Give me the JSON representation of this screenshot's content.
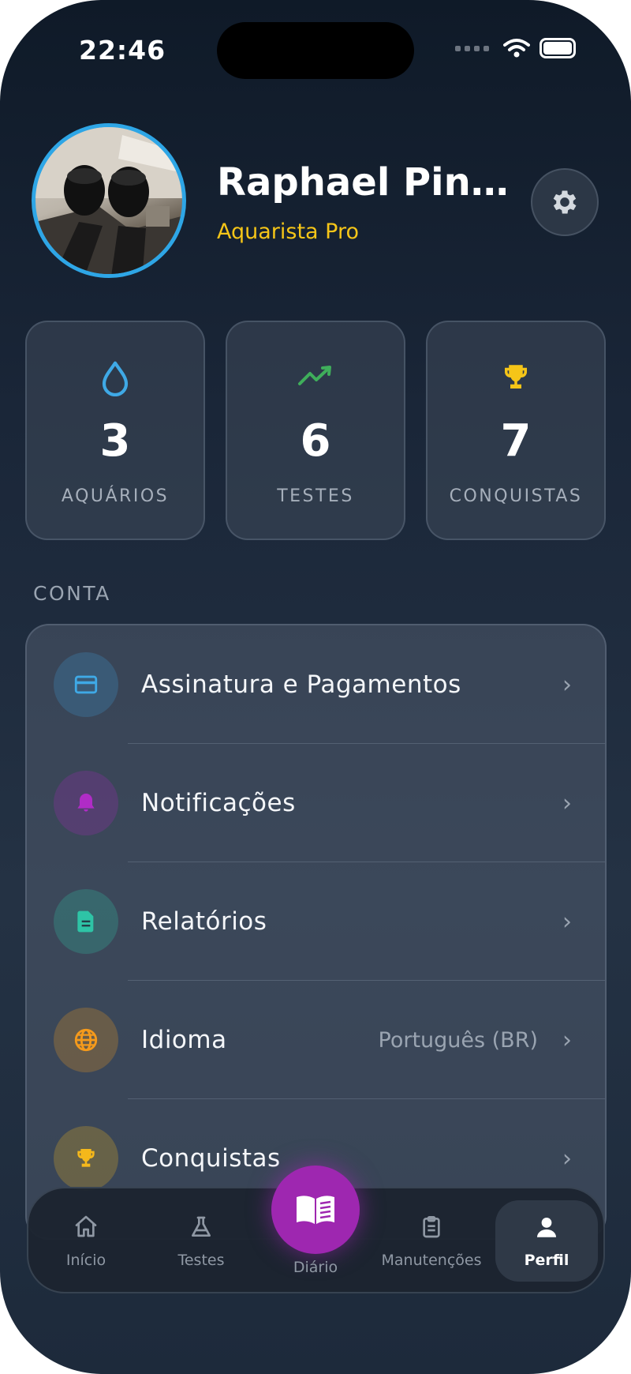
{
  "status_bar": {
    "time": "22:46"
  },
  "profile": {
    "name": "Raphael Pinheir...",
    "tier": "Aquarista Pro"
  },
  "stats": [
    {
      "icon": "water-drop-icon",
      "value": "3",
      "label": "AQUÁRIOS",
      "color": "#3fa9e6"
    },
    {
      "icon": "trending-up-icon",
      "value": "6",
      "label": "TESTES",
      "color": "#3fae5b"
    },
    {
      "icon": "trophy-icon",
      "value": "7",
      "label": "CONQUISTAS",
      "color": "#f5c518"
    }
  ],
  "section_title": "CONTA",
  "menu": [
    {
      "icon": "credit-card-icon",
      "label": "Assinatura e Pagamentos",
      "value": "",
      "color": "#3fa9e6"
    },
    {
      "icon": "bell-icon",
      "label": "Notificações",
      "value": "",
      "color": "#a326b8"
    },
    {
      "icon": "document-icon",
      "label": "Relatórios",
      "value": "",
      "color": "#2ec4a6"
    },
    {
      "icon": "globe-icon",
      "label": "Idioma",
      "value": "Português (BR)",
      "color": "#f59a1b"
    },
    {
      "icon": "trophy-icon",
      "label": "Conquistas",
      "value": "",
      "color": "#f5b81b"
    }
  ],
  "tabs": [
    {
      "icon": "home-icon",
      "label": "Início"
    },
    {
      "icon": "flask-icon",
      "label": "Testes"
    },
    {
      "icon": "book-icon",
      "label": "Diário"
    },
    {
      "icon": "clipboard-icon",
      "label": "Manutenções"
    },
    {
      "icon": "person-icon",
      "label": "Perfil"
    }
  ],
  "active_tab": "Perfil",
  "colors": {
    "accent_purple": "#9e27b0",
    "avatar_ring": "#2ea6e6",
    "tier_gold": "#f5c518"
  }
}
